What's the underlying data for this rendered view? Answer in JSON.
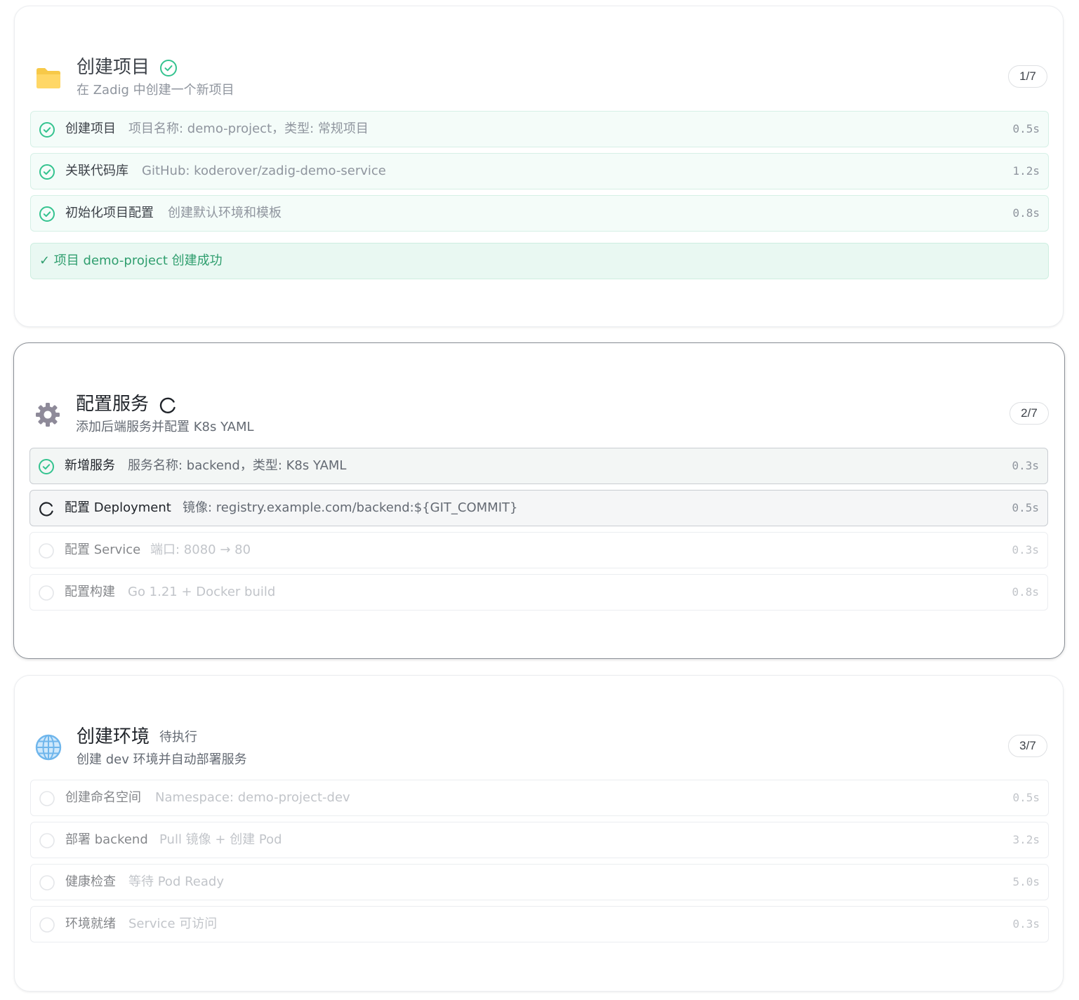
{
  "stages": [
    {
      "title": "创建项目",
      "subtitle": "在 Zadig 中创建一个新项目",
      "badge": "1/7",
      "icon": "folder-icon",
      "status": "done",
      "steps": [
        {
          "name": "创建项目",
          "desc": "项目名称: demo-project，类型: 常规项目",
          "time": "0.5s",
          "status": "done"
        },
        {
          "name": "关联代码库",
          "desc": "GitHub: koderover/zadig-demo-service",
          "time": "1.2s",
          "status": "done"
        },
        {
          "name": "初始化项目配置",
          "desc": "创建默认环境和模板",
          "time": "0.8s",
          "status": "done"
        }
      ],
      "result": "✓ 项目 demo-project 创建成功"
    },
    {
      "title": "配置服务",
      "subtitle": "添加后端服务并配置 K8s YAML",
      "badge": "2/7",
      "icon": "gear-icon",
      "status": "running",
      "steps": [
        {
          "name": "新增服务",
          "desc": "服务名称: backend，类型: K8s YAML",
          "time": "0.3s",
          "status": "done"
        },
        {
          "name": "配置 Deployment",
          "desc": "镜像: registry.example.com/backend:${GIT_COMMIT}",
          "time": "0.5s",
          "status": "running"
        },
        {
          "name": "配置 Service",
          "desc": "端口: 8080 → 80",
          "time": "0.3s",
          "status": "pending"
        },
        {
          "name": "配置构建",
          "desc": "Go 1.21 + Docker build",
          "time": "0.8s",
          "status": "pending"
        }
      ]
    },
    {
      "title": "创建环境",
      "subtitle": "创建 dev 环境并自动部署服务",
      "badge": "3/7",
      "icon": "globe-icon",
      "status": "pending",
      "status_text": "待执行",
      "steps": [
        {
          "name": "创建命名空间",
          "desc": "Namespace: demo-project-dev",
          "time": "0.5s",
          "status": "pending"
        },
        {
          "name": "部署 backend",
          "desc": "Pull 镜像 + 创建 Pod",
          "time": "3.2s",
          "status": "pending"
        },
        {
          "name": "健康检查",
          "desc": "等待 Pod Ready",
          "time": "5.0s",
          "status": "pending"
        },
        {
          "name": "环境就绪",
          "desc": "Service 可访问",
          "time": "0.3s",
          "status": "pending"
        }
      ]
    }
  ],
  "colors": {
    "success": "#34c38f",
    "success_text": "#2f9e6e",
    "muted": "#8f959e"
  }
}
